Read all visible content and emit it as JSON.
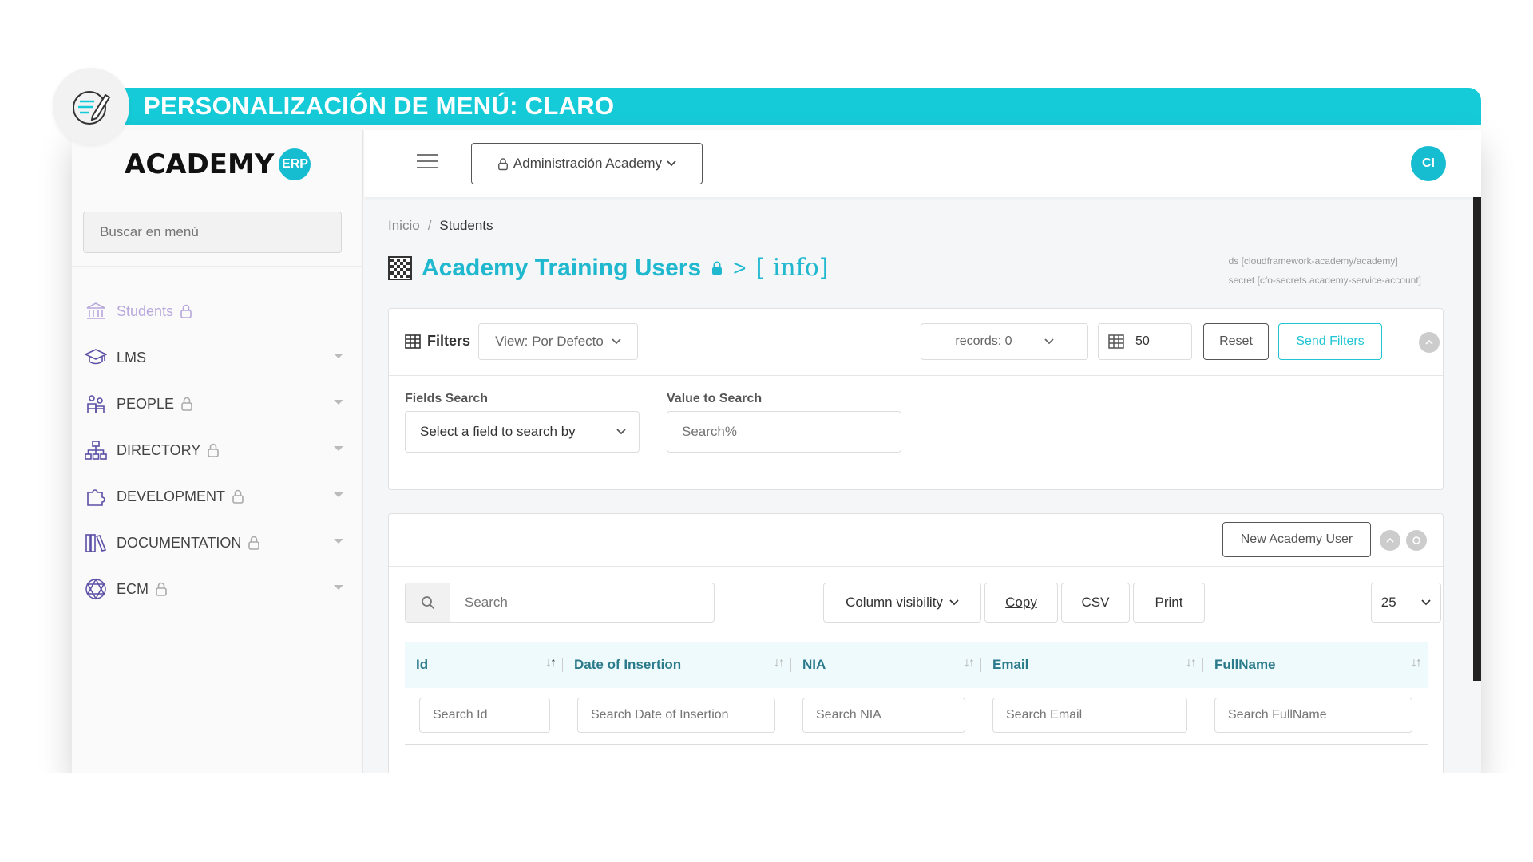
{
  "banner": {
    "title": "PERSONALIZACIÓN DE MENÚ: CLARO"
  },
  "colors": {
    "accent": "#16cbd8",
    "teal_text": "#1fb8cf",
    "active_menu": "#b7a8dc"
  },
  "logo": {
    "text": "ACADEMY",
    "badge": "ERP"
  },
  "sidebar": {
    "search_placeholder": "Buscar en menú",
    "items": [
      {
        "label": "Students",
        "icon": "bank-icon",
        "locked": true,
        "active": true,
        "has_children": false
      },
      {
        "label": "LMS",
        "icon": "graduation-cap-icon",
        "locked": false,
        "has_children": true
      },
      {
        "label": "PEOPLE",
        "icon": "people-icon",
        "locked": true,
        "has_children": true
      },
      {
        "label": "DIRECTORY",
        "icon": "sitemap-icon",
        "locked": true,
        "has_children": true
      },
      {
        "label": "DEVELOPMENT",
        "icon": "puzzle-icon",
        "locked": true,
        "has_children": true
      },
      {
        "label": "DOCUMENTATION",
        "icon": "books-icon",
        "locked": true,
        "has_children": true
      },
      {
        "label": "ECM",
        "icon": "network-icon",
        "locked": true,
        "has_children": true
      }
    ]
  },
  "topbar": {
    "dropdown_label": "Administración Academy",
    "avatar": "CI"
  },
  "breadcrumb": {
    "home": "Inicio",
    "separator": "/",
    "current": "Students"
  },
  "page": {
    "title": "Academy Training Users",
    "arrow": ">",
    "info": "[ info]",
    "ds": "ds [cloudframework-academy/academy]",
    "secret": "secret [cfo-secrets.academy-service-account]"
  },
  "filters": {
    "label": "Filters",
    "view": "View: Por Defecto",
    "records": "records: 0",
    "page_size": "50",
    "reset": "Reset",
    "send": "Send Filters",
    "fields_search_label": "Fields Search",
    "fields_search_value": "Select a field to search by",
    "value_search_label": "Value to Search",
    "value_search_placeholder": "Search%"
  },
  "table": {
    "new_button": "New Academy User",
    "search_placeholder": "Search",
    "column_visibility": "Column visibility",
    "copy": "Copy",
    "csv": "CSV",
    "print": "Print",
    "page_length": "25",
    "columns": [
      {
        "label": "Id",
        "search": "Search Id"
      },
      {
        "label": "Date of Insertion",
        "search": "Search Date of Insertion"
      },
      {
        "label": "NIA",
        "search": "Search NIA"
      },
      {
        "label": "Email",
        "search": "Search Email"
      },
      {
        "label": "FullName",
        "search": "Search FullName"
      }
    ]
  }
}
